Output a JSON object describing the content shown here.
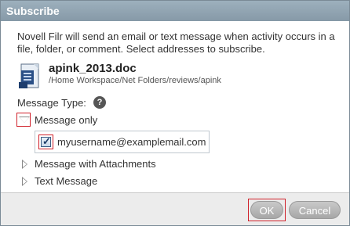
{
  "dialog": {
    "title": "Subscribe",
    "intro": "Novell Filr will send an email or text message when activity occurs in a file, folder, or comment. Select addresses to subscribe.",
    "document": {
      "icon": "word-document-icon",
      "name": "apink_2013.doc",
      "path": "/Home Workspace/Net Folders/reviews/apink"
    },
    "message_type_label": "Message Type:",
    "help_icon": "help-icon",
    "options": {
      "message_only": {
        "label": "Message only",
        "expanded": true,
        "email": "myusername@examplemail.com",
        "email_checked": true
      },
      "message_with_attachments": {
        "label": "Message with Attachments",
        "expanded": false
      },
      "text_message": {
        "label": "Text Message",
        "expanded": false
      }
    },
    "buttons": {
      "ok": "OK",
      "cancel": "Cancel"
    }
  },
  "colors": {
    "titlebar": "#8fa3b1",
    "highlight": "#d0202a",
    "button": "#b8b8b8"
  }
}
